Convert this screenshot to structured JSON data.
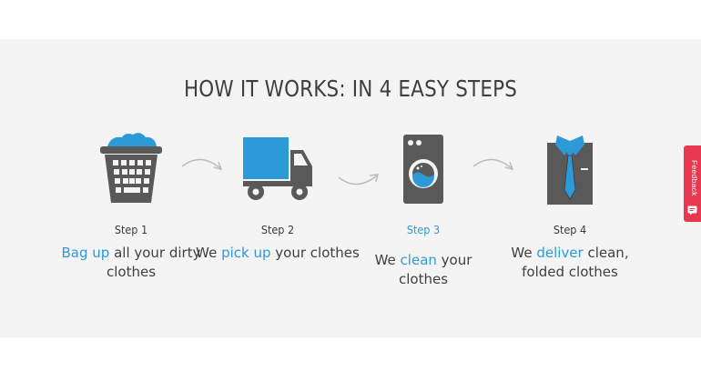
{
  "section": {
    "title": "HOW IT WORKS: IN 4 EASY STEPS",
    "steps": [
      {
        "label": "Step 1",
        "desc_highlight": "Bag up",
        "desc_rest": " all your dirty clothes",
        "active": false
      },
      {
        "label": "Step 2",
        "desc_pre": "We ",
        "desc_highlight": "pick up",
        "desc_rest": " your clothes",
        "active": false
      },
      {
        "label": "Step 3",
        "desc_pre": "We ",
        "desc_highlight": "clean",
        "desc_rest": " your clothes",
        "active": true
      },
      {
        "label": "Step 4",
        "desc_pre": "We ",
        "desc_highlight": "deliver",
        "desc_rest": " clean, folded clothes",
        "active": false
      }
    ]
  },
  "feedback": {
    "label": "Feedback"
  },
  "colors": {
    "accent": "#2c9ad7",
    "icon_gray": "#595959",
    "background": "#f4f4f4",
    "feedback": "#e8384f"
  }
}
